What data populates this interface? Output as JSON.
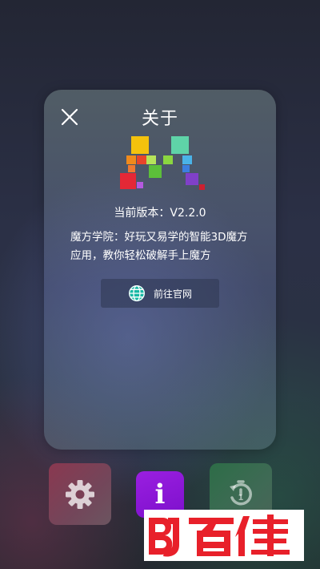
{
  "dialog": {
    "title": "关于",
    "version_text": "当前版本：V2.2.0",
    "description": "魔方学院：好玩又易学的智能3D魔方应用，教你轻松破解手上魔方",
    "website_button_label": "前往官网",
    "close_icon": "close-icon",
    "website_icon": "globe-icon"
  },
  "dock": {
    "settings_icon": "gear-icon",
    "info_label": "i",
    "reset_icon": "timer-reset-icon"
  },
  "watermark": {
    "text": "百佳",
    "logo_text": "BJ",
    "color": "#e8202a"
  },
  "colors": {
    "info_accent": "#8c1adb",
    "settings_bg": "#7d3f55",
    "reset_bg": "#376b4f"
  }
}
